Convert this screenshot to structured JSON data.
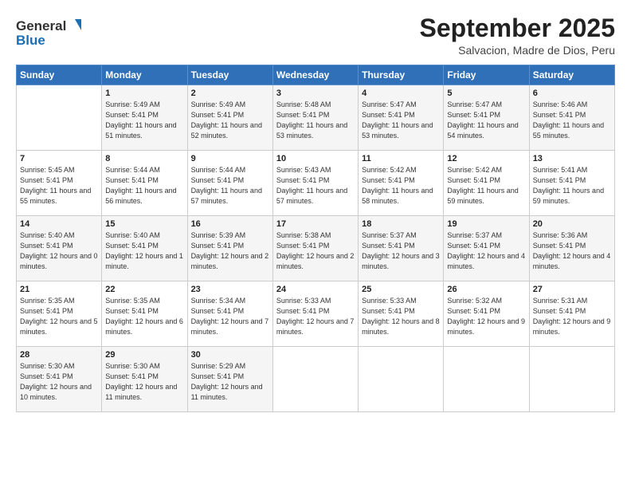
{
  "header": {
    "logo_general": "General",
    "logo_blue": "Blue",
    "month": "September 2025",
    "location": "Salvacion, Madre de Dios, Peru"
  },
  "days_of_week": [
    "Sunday",
    "Monday",
    "Tuesday",
    "Wednesday",
    "Thursday",
    "Friday",
    "Saturday"
  ],
  "weeks": [
    [
      {
        "day": "",
        "sunrise": "",
        "sunset": "",
        "daylight": ""
      },
      {
        "day": "1",
        "sunrise": "Sunrise: 5:49 AM",
        "sunset": "Sunset: 5:41 PM",
        "daylight": "Daylight: 11 hours and 51 minutes."
      },
      {
        "day": "2",
        "sunrise": "Sunrise: 5:49 AM",
        "sunset": "Sunset: 5:41 PM",
        "daylight": "Daylight: 11 hours and 52 minutes."
      },
      {
        "day": "3",
        "sunrise": "Sunrise: 5:48 AM",
        "sunset": "Sunset: 5:41 PM",
        "daylight": "Daylight: 11 hours and 53 minutes."
      },
      {
        "day": "4",
        "sunrise": "Sunrise: 5:47 AM",
        "sunset": "Sunset: 5:41 PM",
        "daylight": "Daylight: 11 hours and 53 minutes."
      },
      {
        "day": "5",
        "sunrise": "Sunrise: 5:47 AM",
        "sunset": "Sunset: 5:41 PM",
        "daylight": "Daylight: 11 hours and 54 minutes."
      },
      {
        "day": "6",
        "sunrise": "Sunrise: 5:46 AM",
        "sunset": "Sunset: 5:41 PM",
        "daylight": "Daylight: 11 hours and 55 minutes."
      }
    ],
    [
      {
        "day": "7",
        "sunrise": "Sunrise: 5:45 AM",
        "sunset": "Sunset: 5:41 PM",
        "daylight": "Daylight: 11 hours and 55 minutes."
      },
      {
        "day": "8",
        "sunrise": "Sunrise: 5:44 AM",
        "sunset": "Sunset: 5:41 PM",
        "daylight": "Daylight: 11 hours and 56 minutes."
      },
      {
        "day": "9",
        "sunrise": "Sunrise: 5:44 AM",
        "sunset": "Sunset: 5:41 PM",
        "daylight": "Daylight: 11 hours and 57 minutes."
      },
      {
        "day": "10",
        "sunrise": "Sunrise: 5:43 AM",
        "sunset": "Sunset: 5:41 PM",
        "daylight": "Daylight: 11 hours and 57 minutes."
      },
      {
        "day": "11",
        "sunrise": "Sunrise: 5:42 AM",
        "sunset": "Sunset: 5:41 PM",
        "daylight": "Daylight: 11 hours and 58 minutes."
      },
      {
        "day": "12",
        "sunrise": "Sunrise: 5:42 AM",
        "sunset": "Sunset: 5:41 PM",
        "daylight": "Daylight: 11 hours and 59 minutes."
      },
      {
        "day": "13",
        "sunrise": "Sunrise: 5:41 AM",
        "sunset": "Sunset: 5:41 PM",
        "daylight": "Daylight: 11 hours and 59 minutes."
      }
    ],
    [
      {
        "day": "14",
        "sunrise": "Sunrise: 5:40 AM",
        "sunset": "Sunset: 5:41 PM",
        "daylight": "Daylight: 12 hours and 0 minutes."
      },
      {
        "day": "15",
        "sunrise": "Sunrise: 5:40 AM",
        "sunset": "Sunset: 5:41 PM",
        "daylight": "Daylight: 12 hours and 1 minute."
      },
      {
        "day": "16",
        "sunrise": "Sunrise: 5:39 AM",
        "sunset": "Sunset: 5:41 PM",
        "daylight": "Daylight: 12 hours and 2 minutes."
      },
      {
        "day": "17",
        "sunrise": "Sunrise: 5:38 AM",
        "sunset": "Sunset: 5:41 PM",
        "daylight": "Daylight: 12 hours and 2 minutes."
      },
      {
        "day": "18",
        "sunrise": "Sunrise: 5:37 AM",
        "sunset": "Sunset: 5:41 PM",
        "daylight": "Daylight: 12 hours and 3 minutes."
      },
      {
        "day": "19",
        "sunrise": "Sunrise: 5:37 AM",
        "sunset": "Sunset: 5:41 PM",
        "daylight": "Daylight: 12 hours and 4 minutes."
      },
      {
        "day": "20",
        "sunrise": "Sunrise: 5:36 AM",
        "sunset": "Sunset: 5:41 PM",
        "daylight": "Daylight: 12 hours and 4 minutes."
      }
    ],
    [
      {
        "day": "21",
        "sunrise": "Sunrise: 5:35 AM",
        "sunset": "Sunset: 5:41 PM",
        "daylight": "Daylight: 12 hours and 5 minutes."
      },
      {
        "day": "22",
        "sunrise": "Sunrise: 5:35 AM",
        "sunset": "Sunset: 5:41 PM",
        "daylight": "Daylight: 12 hours and 6 minutes."
      },
      {
        "day": "23",
        "sunrise": "Sunrise: 5:34 AM",
        "sunset": "Sunset: 5:41 PM",
        "daylight": "Daylight: 12 hours and 7 minutes."
      },
      {
        "day": "24",
        "sunrise": "Sunrise: 5:33 AM",
        "sunset": "Sunset: 5:41 PM",
        "daylight": "Daylight: 12 hours and 7 minutes."
      },
      {
        "day": "25",
        "sunrise": "Sunrise: 5:33 AM",
        "sunset": "Sunset: 5:41 PM",
        "daylight": "Daylight: 12 hours and 8 minutes."
      },
      {
        "day": "26",
        "sunrise": "Sunrise: 5:32 AM",
        "sunset": "Sunset: 5:41 PM",
        "daylight": "Daylight: 12 hours and 9 minutes."
      },
      {
        "day": "27",
        "sunrise": "Sunrise: 5:31 AM",
        "sunset": "Sunset: 5:41 PM",
        "daylight": "Daylight: 12 hours and 9 minutes."
      }
    ],
    [
      {
        "day": "28",
        "sunrise": "Sunrise: 5:30 AM",
        "sunset": "Sunset: 5:41 PM",
        "daylight": "Daylight: 12 hours and 10 minutes."
      },
      {
        "day": "29",
        "sunrise": "Sunrise: 5:30 AM",
        "sunset": "Sunset: 5:41 PM",
        "daylight": "Daylight: 12 hours and 11 minutes."
      },
      {
        "day": "30",
        "sunrise": "Sunrise: 5:29 AM",
        "sunset": "Sunset: 5:41 PM",
        "daylight": "Daylight: 12 hours and 11 minutes."
      },
      {
        "day": "",
        "sunrise": "",
        "sunset": "",
        "daylight": ""
      },
      {
        "day": "",
        "sunrise": "",
        "sunset": "",
        "daylight": ""
      },
      {
        "day": "",
        "sunrise": "",
        "sunset": "",
        "daylight": ""
      },
      {
        "day": "",
        "sunrise": "",
        "sunset": "",
        "daylight": ""
      }
    ]
  ]
}
